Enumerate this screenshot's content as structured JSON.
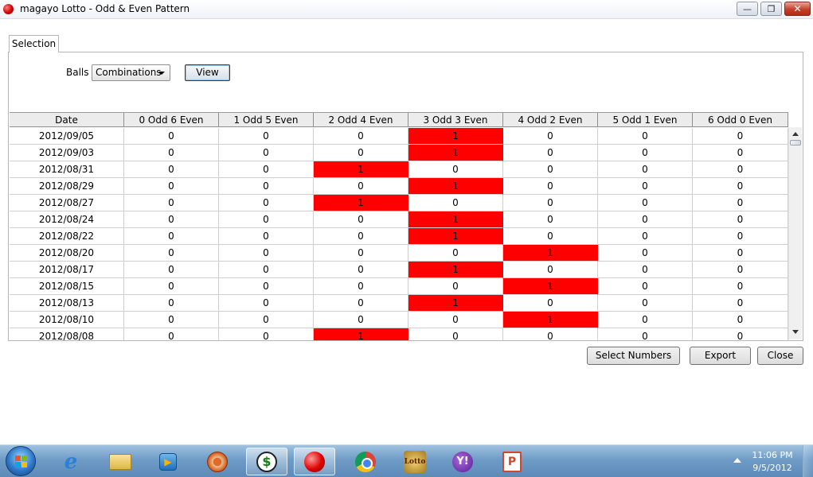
{
  "window": {
    "title": "magayo Lotto - Odd & Even Pattern",
    "minimize_label": "—",
    "maximize_label": "❐",
    "close_label": "✕"
  },
  "tabs": [
    {
      "label": "Selection",
      "selected": true
    }
  ],
  "controls": {
    "balls_label": "Balls",
    "balls_value": "Combinations",
    "view_label": "View"
  },
  "table": {
    "columns": [
      "Date",
      "0 Odd 6 Even",
      "1 Odd 5 Even",
      "2 Odd 4 Even",
      "3 Odd 3 Even",
      "4 Odd 2 Even",
      "5 Odd 1 Even",
      "6 Odd 0 Even"
    ],
    "highlight_color": "#ff0000",
    "rows": [
      {
        "date": "2012/09/05",
        "values": [
          "0",
          "0",
          "0",
          "1",
          "0",
          "0",
          "0"
        ]
      },
      {
        "date": "2012/09/03",
        "values": [
          "0",
          "0",
          "0",
          "1",
          "0",
          "0",
          "0"
        ]
      },
      {
        "date": "2012/08/31",
        "values": [
          "0",
          "0",
          "1",
          "0",
          "0",
          "0",
          "0"
        ]
      },
      {
        "date": "2012/08/29",
        "values": [
          "0",
          "0",
          "0",
          "1",
          "0",
          "0",
          "0"
        ]
      },
      {
        "date": "2012/08/27",
        "values": [
          "0",
          "0",
          "1",
          "0",
          "0",
          "0",
          "0"
        ]
      },
      {
        "date": "2012/08/24",
        "values": [
          "0",
          "0",
          "0",
          "1",
          "0",
          "0",
          "0"
        ]
      },
      {
        "date": "2012/08/22",
        "values": [
          "0",
          "0",
          "0",
          "1",
          "0",
          "0",
          "0"
        ]
      },
      {
        "date": "2012/08/20",
        "values": [
          "0",
          "0",
          "0",
          "0",
          "1",
          "0",
          "0"
        ]
      },
      {
        "date": "2012/08/17",
        "values": [
          "0",
          "0",
          "0",
          "1",
          "0",
          "0",
          "0"
        ]
      },
      {
        "date": "2012/08/15",
        "values": [
          "0",
          "0",
          "0",
          "0",
          "1",
          "0",
          "0"
        ]
      },
      {
        "date": "2012/08/13",
        "values": [
          "0",
          "0",
          "0",
          "1",
          "0",
          "0",
          "0"
        ]
      },
      {
        "date": "2012/08/10",
        "values": [
          "0",
          "0",
          "0",
          "0",
          "1",
          "0",
          "0"
        ]
      },
      {
        "date": "2012/08/08",
        "values": [
          "0",
          "0",
          "1",
          "0",
          "0",
          "0",
          "0"
        ]
      }
    ]
  },
  "buttons": {
    "select_numbers": "Select Numbers",
    "export": "Export",
    "close": "Close"
  },
  "taskbar": {
    "items": [
      {
        "name": "internet-explorer-icon",
        "glyph": "e",
        "active": false
      },
      {
        "name": "folder-icon",
        "glyph": "",
        "active": false
      },
      {
        "name": "media-player-icon",
        "glyph": "▶",
        "active": false
      },
      {
        "name": "film-reel-icon",
        "glyph": "",
        "active": false
      },
      {
        "name": "dollar-app-icon",
        "glyph": "$",
        "active": true
      },
      {
        "name": "red-ball-icon",
        "glyph": "",
        "active": true
      },
      {
        "name": "chrome-icon",
        "glyph": "",
        "active": false
      },
      {
        "name": "lotto-icon",
        "glyph": "Lotto",
        "active": false
      },
      {
        "name": "yahoo-messenger-icon",
        "glyph": "Y!",
        "active": false
      },
      {
        "name": "powerpoint-icon",
        "glyph": "P",
        "active": false
      }
    ],
    "clock_time": "11:06 PM",
    "clock_date": "9/5/2012"
  }
}
